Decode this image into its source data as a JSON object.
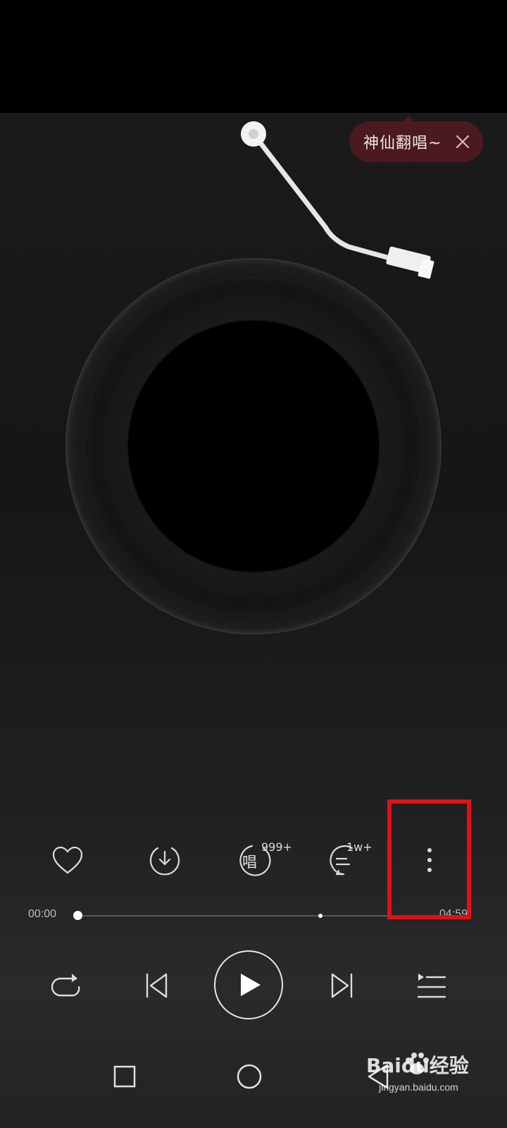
{
  "popup": {
    "text": "神仙翻唱~"
  },
  "actions": {
    "sing_badge": "999+",
    "sing_glyph": "唱",
    "comment_badge": "1w+"
  },
  "progress": {
    "current": "00:00",
    "total": "04:59",
    "fraction": 0.0
  },
  "watermark": {
    "brand": "Baidu经验",
    "url": "jingyan.baidu.com"
  },
  "colors": {
    "highlight": "#e01018",
    "popup_bg": "#4a1a20"
  }
}
